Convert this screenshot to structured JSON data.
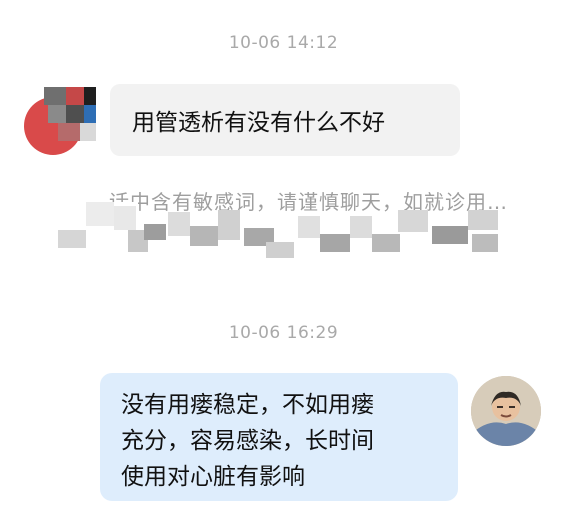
{
  "messages": [
    {
      "timestamp": "10-06 14:12",
      "sender": "other",
      "text": "用管透析有没有什么不好"
    },
    {
      "notice": "…话中含有敏感词，请谨慎聊天，如就诊用…"
    },
    {
      "timestamp": "10-06 16:29",
      "sender": "self",
      "lines": [
        "没有用瘘稳定，不如用瘘",
        "充分，容易感染，长时间",
        "使用对心脏有影响"
      ]
    }
  ],
  "colors": {
    "timestamp": "#a9a9a9",
    "left_bubble": "#f2f2f2",
    "right_bubble": "#deedfc",
    "text": "#111111"
  },
  "icons": {
    "left_avatar": "avatar-icon",
    "right_avatar": "avatar-icon"
  }
}
